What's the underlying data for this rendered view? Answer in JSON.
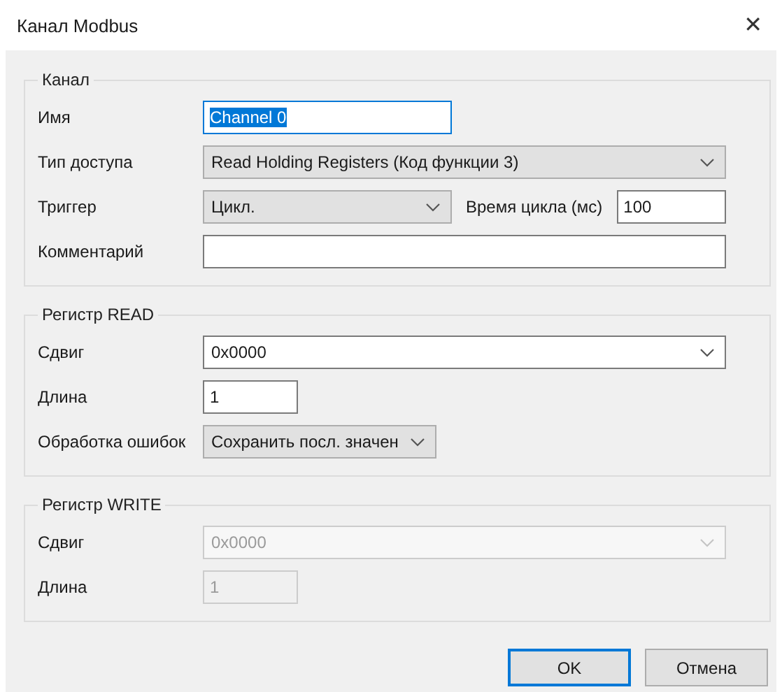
{
  "window": {
    "title": "Канал Modbus",
    "close": "✕"
  },
  "groups": [
    {
      "title": "Канал",
      "rows": [
        {
          "label": "Имя",
          "controls": [
            {
              "kind": "half-input",
              "value": "Channel 0",
              "focused": true,
              "text_selected": true,
              "disabled": false
            }
          ]
        },
        {
          "label": "Тип доступа",
          "controls": [
            {
              "kind": "wide-combo",
              "value": "Read Holding Registers (Код функции 3)",
              "disabled": false
            }
          ]
        },
        {
          "label": "Триггер",
          "controls": [
            {
              "kind": "half-combo",
              "value": "Цикл.",
              "disabled": false
            },
            {
              "kind": "label",
              "text": "Время цикла (мс)"
            },
            {
              "kind": "fill-input",
              "value": "100",
              "disabled": false
            }
          ]
        },
        {
          "label": "Комментарий",
          "controls": [
            {
              "kind": "wide-input",
              "disabled": false
            }
          ]
        }
      ]
    },
    {
      "title": "Регистр READ",
      "rows": [
        {
          "label": "Сдвиг",
          "controls": [
            {
              "kind": "wide-edit-combo",
              "value": "0x0000",
              "disabled": false
            }
          ]
        },
        {
          "label": "Длина",
          "controls": [
            {
              "kind": "short-input",
              "value": "1",
              "disabled": false
            }
          ]
        },
        {
          "label": "Обработка ошибок",
          "controls": [
            {
              "kind": "fit-combo",
              "value": "Сохранить посл. значен",
              "disabled": false
            }
          ]
        }
      ]
    },
    {
      "title": "Регистр WRITE",
      "rows": [
        {
          "label": "Сдвиг",
          "controls": [
            {
              "kind": "wide-edit-combo",
              "value": "0x0000",
              "disabled": true
            }
          ]
        },
        {
          "label": "Длина",
          "controls": [
            {
              "kind": "short-input",
              "value": "1",
              "disabled": true
            }
          ]
        }
      ]
    }
  ],
  "buttons": [
    {
      "label": "OK",
      "default": true
    },
    {
      "label": "Отмена",
      "default": false
    }
  ]
}
